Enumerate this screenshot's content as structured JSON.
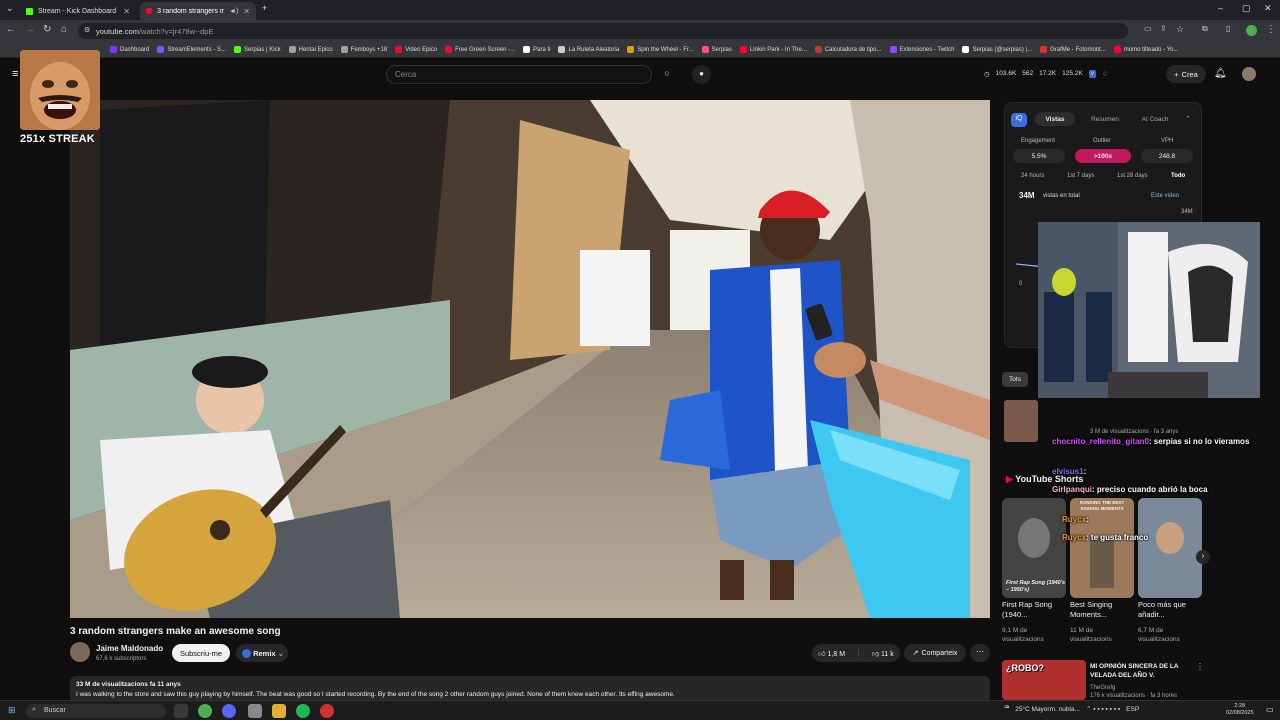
{
  "browser": {
    "tabs": [
      {
        "label": "Stream - Kick Dashboard",
        "active": false
      },
      {
        "label": "3 random strangers make ...",
        "active": true
      }
    ],
    "url_host": "youtube.com",
    "url_path": "/watch?v=jr478w--dpE",
    "bookmarks": [
      {
        "label": "Dashboard",
        "color": "#7c3aed"
      },
      {
        "label": "StreamElements - S...",
        "color": "#6d5dfc"
      },
      {
        "label": "Serpias | Kick",
        "color": "#53fc18"
      },
      {
        "label": "Hentai Epico",
        "color": "#a0a0a0"
      },
      {
        "label": "Femboys +18",
        "color": "#a0a0a0"
      },
      {
        "label": "Video Epico",
        "color": "#ff0033"
      },
      {
        "label": "Free Green Screen -...",
        "color": "#ff0033"
      },
      {
        "label": "Para ti",
        "color": "#ffffff"
      },
      {
        "label": "La Ruleta Aleatoria",
        "color": "#cccccc"
      },
      {
        "label": "Spin the Wheel - Fr...",
        "color": "#e0a000"
      },
      {
        "label": "Serpias",
        "color": "#ff4f7b"
      },
      {
        "label": "Linkin Park - In The...",
        "color": "#ff0033"
      },
      {
        "label": "Calculadora de tipo...",
        "color": "#c0392b"
      },
      {
        "label": "Extensiones - Twitch",
        "color": "#9146ff"
      },
      {
        "label": "Serpias (@serpias) |...",
        "color": "#ffffff"
      },
      {
        "label": "GrafMe - Fotomont...",
        "color": "#e03030"
      },
      {
        "label": "momo tilteado - Yo...",
        "color": "#ff0033"
      }
    ]
  },
  "yt": {
    "search_placeholder": "Cerca",
    "stats": [
      "103.6K",
      "562",
      "17.2K",
      "125.2K"
    ],
    "create_label": "Crea"
  },
  "overlay": {
    "streak": "251x STREAK"
  },
  "video": {
    "title": "3 random strangers make an awesome song",
    "channel": "Jaime Maldonado",
    "subscribers": "67,6 k subscriptors",
    "subscribe_label": "Subscriu-me",
    "remix_label": "Remix",
    "likes": "1,8 M",
    "dislikes": "11 k",
    "share_label": "Comparteix",
    "views_meta": "33 M de visualitzacions  fa 11 anys",
    "description": "I was walking to the store and saw this guy playing by himself. The beat was good so I started recording. By the end of the song 2 other random guys joined.  None of them knew each other. Its effing awesome."
  },
  "panel": {
    "tabs": [
      "Vistas",
      "Resumen",
      "AI Coach"
    ],
    "metrics": [
      {
        "label": "Engagement",
        "value": "5.5%"
      },
      {
        "label": "Outlier",
        "value": ">100x"
      },
      {
        "label": "VPH",
        "value": "248.8"
      }
    ],
    "ranges": [
      "24 hours",
      "1st 7 days",
      "1st 28 days",
      "Todo"
    ],
    "total": "34M",
    "total_label": "vistas en total",
    "legend": "Este video",
    "axis_top": "34M",
    "axis_zero": "0"
  },
  "chat": [
    {
      "user": "chocnito_rellenito_gitan0",
      "text": ": serpias si no lo vieramos"
    },
    {
      "user": "elvisus1",
      "text": ": "
    },
    {
      "user": "Girlpanqui",
      "text": ": preciso cuando abrió la boca"
    },
    {
      "user": "Ruycx",
      "text": ": "
    },
    {
      "user": "Ruycx",
      "text": ": te gusta franco"
    }
  ],
  "sidebar": {
    "tots_label": "Tots",
    "rec1_meta": "3 M de visualitzacions · fa 3 anys",
    "shorts_header": "YouTube Shorts",
    "shorts": [
      {
        "title": "First Rap Song (1940...",
        "views": "9,1 M de visualitzacions",
        "caption": "First Rap Song (1940's – 1950's)",
        "color": "#3a3a3a"
      },
      {
        "title": "Best Singing Moments...",
        "views": "11 M de visualitzacions",
        "caption": "RANKING THE BEST SINGING MOMENTS",
        "color": "#8a6a4a"
      },
      {
        "title": "Poco más que añadir...",
        "views": "6,7 M de visualitzacions",
        "caption": "",
        "color": "#6a7a8a"
      }
    ],
    "rec2_title": "MI OPINIÓN SINCERA DE LA VELADA DEL AÑO V.",
    "rec2_channel": "TheGrefg",
    "rec2_meta": "176 k visualitzacions · fa 3 hores",
    "rec2_thumb_text": "¿ROBO?"
  },
  "taskbar": {
    "search_label": "Buscar",
    "weather": "25°C  Mayorm. nubla...",
    "lang": "ESP",
    "time": "2:28",
    "date": "02/08/2025"
  }
}
